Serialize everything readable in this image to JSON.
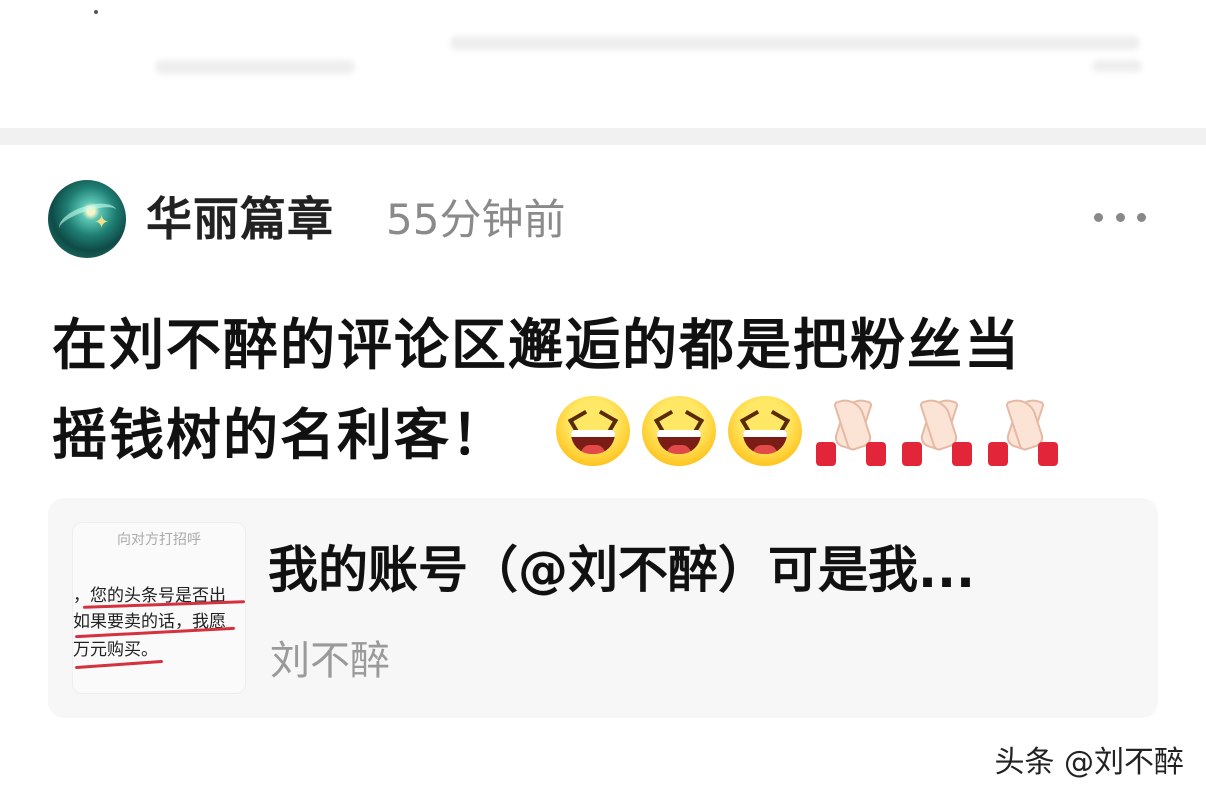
{
  "post": {
    "author": "华丽篇章",
    "time": "55分钟前",
    "text_line1": "在刘不醉的评论区邂逅的都是把粉丝当",
    "text_line2": "摇钱树的名利客！",
    "emojis": [
      "laughing-face",
      "laughing-face",
      "laughing-face",
      "folded-hands",
      "folded-hands",
      "folded-hands"
    ]
  },
  "card": {
    "title": "我的账号（@刘不醉）可是我...",
    "source": "刘不醉",
    "thumbnail": {
      "hint": "向对方打招呼",
      "line1": "，您的头条号是否出",
      "line2": "如果要卖的话，我愿",
      "line3": "万元购买。"
    }
  },
  "watermark": "头条 @刘不醉",
  "colors": {
    "accent_red": "#d3323e",
    "muted_text": "#8a8a8a",
    "card_bg": "#f7f7f7"
  }
}
